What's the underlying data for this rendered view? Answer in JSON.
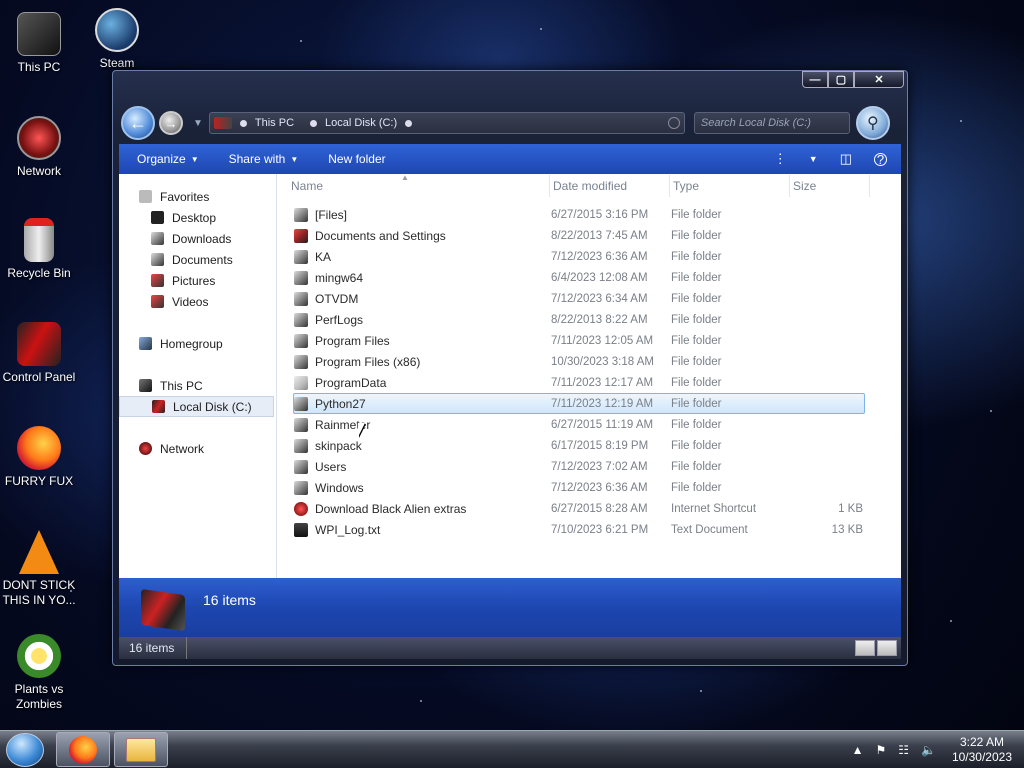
{
  "desktop": {
    "icons": [
      {
        "label": "This PC"
      },
      {
        "label": "Steam"
      },
      {
        "label": "Network"
      },
      {
        "label": "Recycle Bin"
      },
      {
        "label": "Control Panel"
      },
      {
        "label": "FURRY FUX"
      },
      {
        "label": "DONT STICK THIS IN YO..."
      },
      {
        "label": "Plants vs Zombies"
      }
    ]
  },
  "window": {
    "caption": {
      "minimize": "—",
      "maximize": "▢",
      "close": "✕"
    },
    "address": {
      "crumbs": [
        "This PC",
        "Local Disk (C:)"
      ]
    },
    "search": {
      "placeholder": "Search Local Disk (C:)"
    },
    "toolbar": {
      "organize": "Organize",
      "share_with": "Share with",
      "new_folder": "New folder"
    },
    "nav_pane": {
      "favorites": "Favorites",
      "favorites_items": [
        "Desktop",
        "Downloads",
        "Documents",
        "Pictures",
        "Videos"
      ],
      "homegroup": "Homegroup",
      "this_pc": "This PC",
      "local_disk": "Local Disk (C:)",
      "network": "Network"
    },
    "columns": {
      "name": "Name",
      "date": "Date modified",
      "type": "Type",
      "size": "Size"
    },
    "files": [
      {
        "name": "[Files]",
        "date": "6/27/2015 3:16 PM",
        "type": "File folder",
        "size": ""
      },
      {
        "name": "Documents and Settings",
        "date": "8/22/2013 7:45 AM",
        "type": "File folder",
        "size": ""
      },
      {
        "name": "KA",
        "date": "7/12/2023 6:36 AM",
        "type": "File folder",
        "size": ""
      },
      {
        "name": "mingw64",
        "date": "6/4/2023 12:08 AM",
        "type": "File folder",
        "size": ""
      },
      {
        "name": "OTVDM",
        "date": "7/12/2023 6:34 AM",
        "type": "File folder",
        "size": ""
      },
      {
        "name": "PerfLogs",
        "date": "8/22/2013 8:22 AM",
        "type": "File folder",
        "size": ""
      },
      {
        "name": "Program Files",
        "date": "7/11/2023 12:05 AM",
        "type": "File folder",
        "size": ""
      },
      {
        "name": "Program Files (x86)",
        "date": "10/30/2023 3:18 AM",
        "type": "File folder",
        "size": ""
      },
      {
        "name": "ProgramData",
        "date": "7/11/2023 12:17 AM",
        "type": "File folder",
        "size": ""
      },
      {
        "name": "Python27",
        "date": "7/11/2023 12:19 AM",
        "type": "File folder",
        "size": ""
      },
      {
        "name": "Rainmeter",
        "date": "6/27/2015 11:19 AM",
        "type": "File folder",
        "size": ""
      },
      {
        "name": "skinpack",
        "date": "6/17/2015 8:19 PM",
        "type": "File folder",
        "size": ""
      },
      {
        "name": "Users",
        "date": "7/12/2023 7:02 AM",
        "type": "File folder",
        "size": ""
      },
      {
        "name": "Windows",
        "date": "7/12/2023 6:36 AM",
        "type": "File folder",
        "size": ""
      },
      {
        "name": "Download Black Alien extras",
        "date": "6/27/2015 8:28 AM",
        "type": "Internet Shortcut",
        "size": "1 KB"
      },
      {
        "name": "WPI_Log.txt",
        "date": "7/10/2023 6:21 PM",
        "type": "Text Document",
        "size": "13 KB"
      }
    ],
    "details_count": "16 items",
    "status_count": "16 items"
  },
  "taskbar": {
    "time": "3:22 AM",
    "date": "10/30/2023"
  },
  "colors": {
    "toolbar_blue": "#2f63d6",
    "selection": "#cfe6fb"
  }
}
